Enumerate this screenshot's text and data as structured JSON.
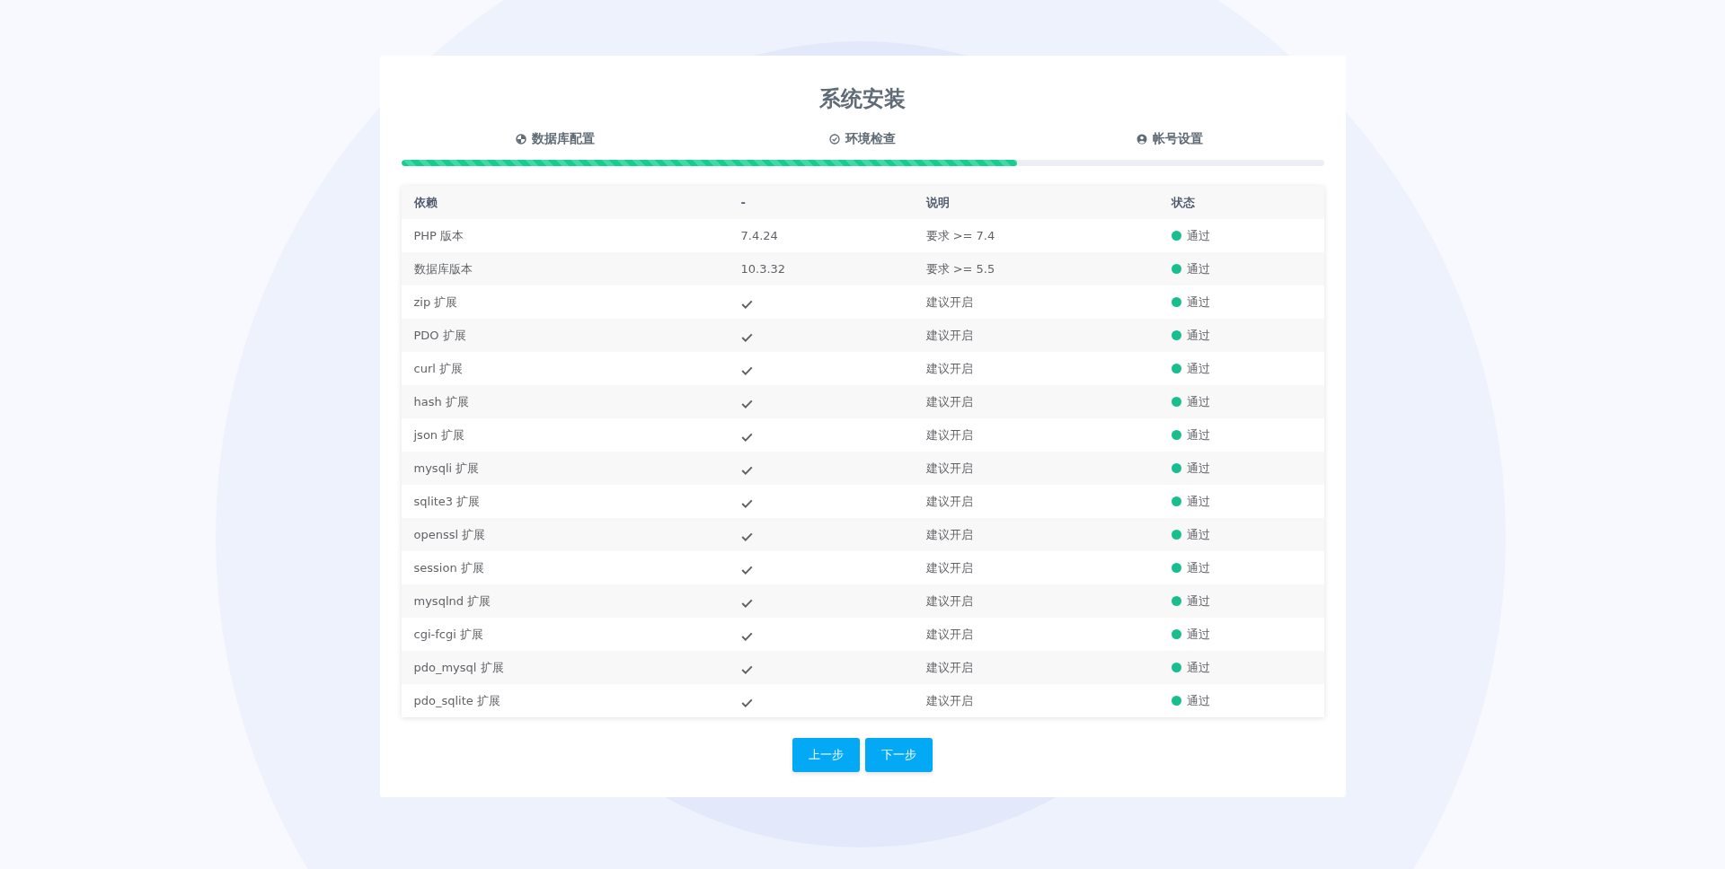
{
  "title": "系统安装",
  "steps": [
    {
      "label": "数据库配置"
    },
    {
      "label": "环境检查"
    },
    {
      "label": "帐号设置"
    }
  ],
  "progress": {
    "level": 0.667
  },
  "table": {
    "columns": [
      "依赖",
      "-",
      "说明",
      "状态"
    ],
    "rows": [
      {
        "name": "PHP 版本",
        "kind": "text",
        "value": "7.4.24",
        "note": "要求 >= 7.4",
        "status": "通过",
        "passed": true
      },
      {
        "name": "数据库版本",
        "kind": "text",
        "value": "10.3.32",
        "note": "要求 >= 5.5",
        "status": "通过",
        "passed": true
      },
      {
        "name": "zip 扩展",
        "kind": "check",
        "note": "建议开启",
        "status": "通过",
        "passed": true
      },
      {
        "name": "PDO 扩展",
        "kind": "check",
        "note": "建议开启",
        "status": "通过",
        "passed": true
      },
      {
        "name": "curl 扩展",
        "kind": "check",
        "note": "建议开启",
        "status": "通过",
        "passed": true
      },
      {
        "name": "hash 扩展",
        "kind": "check",
        "note": "建议开启",
        "status": "通过",
        "passed": true
      },
      {
        "name": "json 扩展",
        "kind": "check",
        "note": "建议开启",
        "status": "通过",
        "passed": true
      },
      {
        "name": "mysqli 扩展",
        "kind": "check",
        "note": "建议开启",
        "status": "通过",
        "passed": true
      },
      {
        "name": "sqlite3 扩展",
        "kind": "check",
        "note": "建议开启",
        "status": "通过",
        "passed": true
      },
      {
        "name": "openssl 扩展",
        "kind": "check",
        "note": "建议开启",
        "status": "通过",
        "passed": true
      },
      {
        "name": "session 扩展",
        "kind": "check",
        "note": "建议开启",
        "status": "通过",
        "passed": true
      },
      {
        "name": "mysqlnd 扩展",
        "kind": "check",
        "note": "建议开启",
        "status": "通过",
        "passed": true
      },
      {
        "name": "cgi-fcgi 扩展",
        "kind": "check",
        "note": "建议开启",
        "status": "通过",
        "passed": true
      },
      {
        "name": "pdo_mysql 扩展",
        "kind": "check",
        "note": "建议开启",
        "status": "通过",
        "passed": true
      },
      {
        "name": "pdo_sqlite 扩展",
        "kind": "check",
        "note": "建议开启",
        "status": "通过",
        "passed": true
      }
    ]
  },
  "buttons": [
    "上一步",
    "下一步"
  ]
}
